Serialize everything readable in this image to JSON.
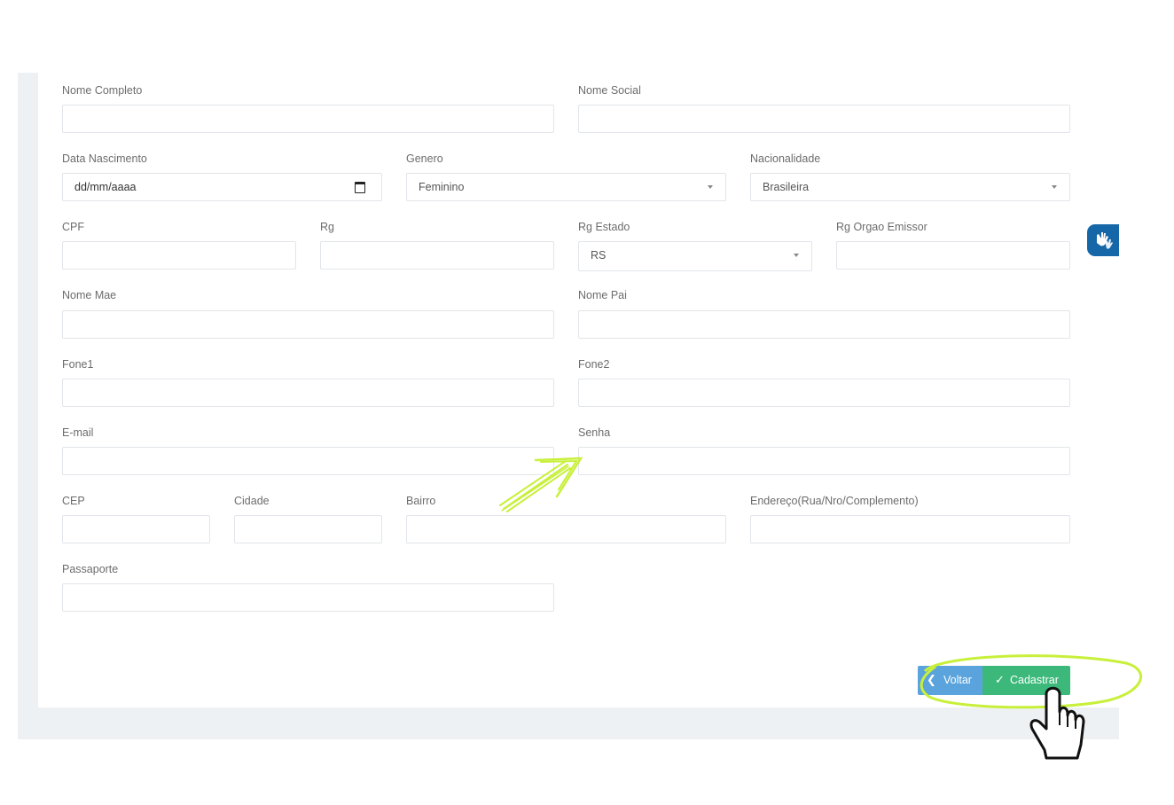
{
  "form": {
    "nome_completo": {
      "label": "Nome Completo",
      "value": ""
    },
    "nome_social": {
      "label": "Nome Social",
      "value": ""
    },
    "data_nascimento": {
      "label": "Data Nascimento",
      "value": "dd/mm/aaaa"
    },
    "genero": {
      "label": "Genero",
      "selected": "Feminino"
    },
    "nacionalidade": {
      "label": "Nacionalidade",
      "selected": "Brasileira"
    },
    "cpf": {
      "label": "CPF",
      "value": ""
    },
    "rg": {
      "label": "Rg",
      "value": ""
    },
    "rg_estado": {
      "label": "Rg Estado",
      "selected": "RS"
    },
    "rg_orgao": {
      "label": "Rg Orgao Emissor",
      "value": ""
    },
    "nome_mae": {
      "label": "Nome Mae",
      "value": ""
    },
    "nome_pai": {
      "label": "Nome Pai",
      "value": ""
    },
    "fone1": {
      "label": "Fone1",
      "value": ""
    },
    "fone2": {
      "label": "Fone2",
      "value": ""
    },
    "email": {
      "label": "E-mail",
      "value": ""
    },
    "senha": {
      "label": "Senha",
      "value": ""
    },
    "cep": {
      "label": "CEP",
      "value": ""
    },
    "cidade": {
      "label": "Cidade",
      "value": ""
    },
    "bairro": {
      "label": "Bairro",
      "value": ""
    },
    "endereco": {
      "label": "Endereço(Rua/Nro/Complemento)",
      "value": ""
    },
    "passaporte": {
      "label": "Passaporte",
      "value": ""
    }
  },
  "actions": {
    "back_label": "Voltar",
    "submit_label": "Cadastrar"
  },
  "icons": {
    "calendar": "calendar-icon",
    "back": "chevron-left-icon",
    "submit": "check-icon",
    "accessibility": "sign-language-hands-icon",
    "annotation_arrow": "arrow-icon",
    "annotation_cursor": "hand-pointer-icon"
  },
  "colors": {
    "voltar_button": "#5aa3dc",
    "cadastrar_button": "#3cb97a",
    "accessibility_widget": "#1667a7",
    "annotation_highlight": "#c8f03a"
  }
}
